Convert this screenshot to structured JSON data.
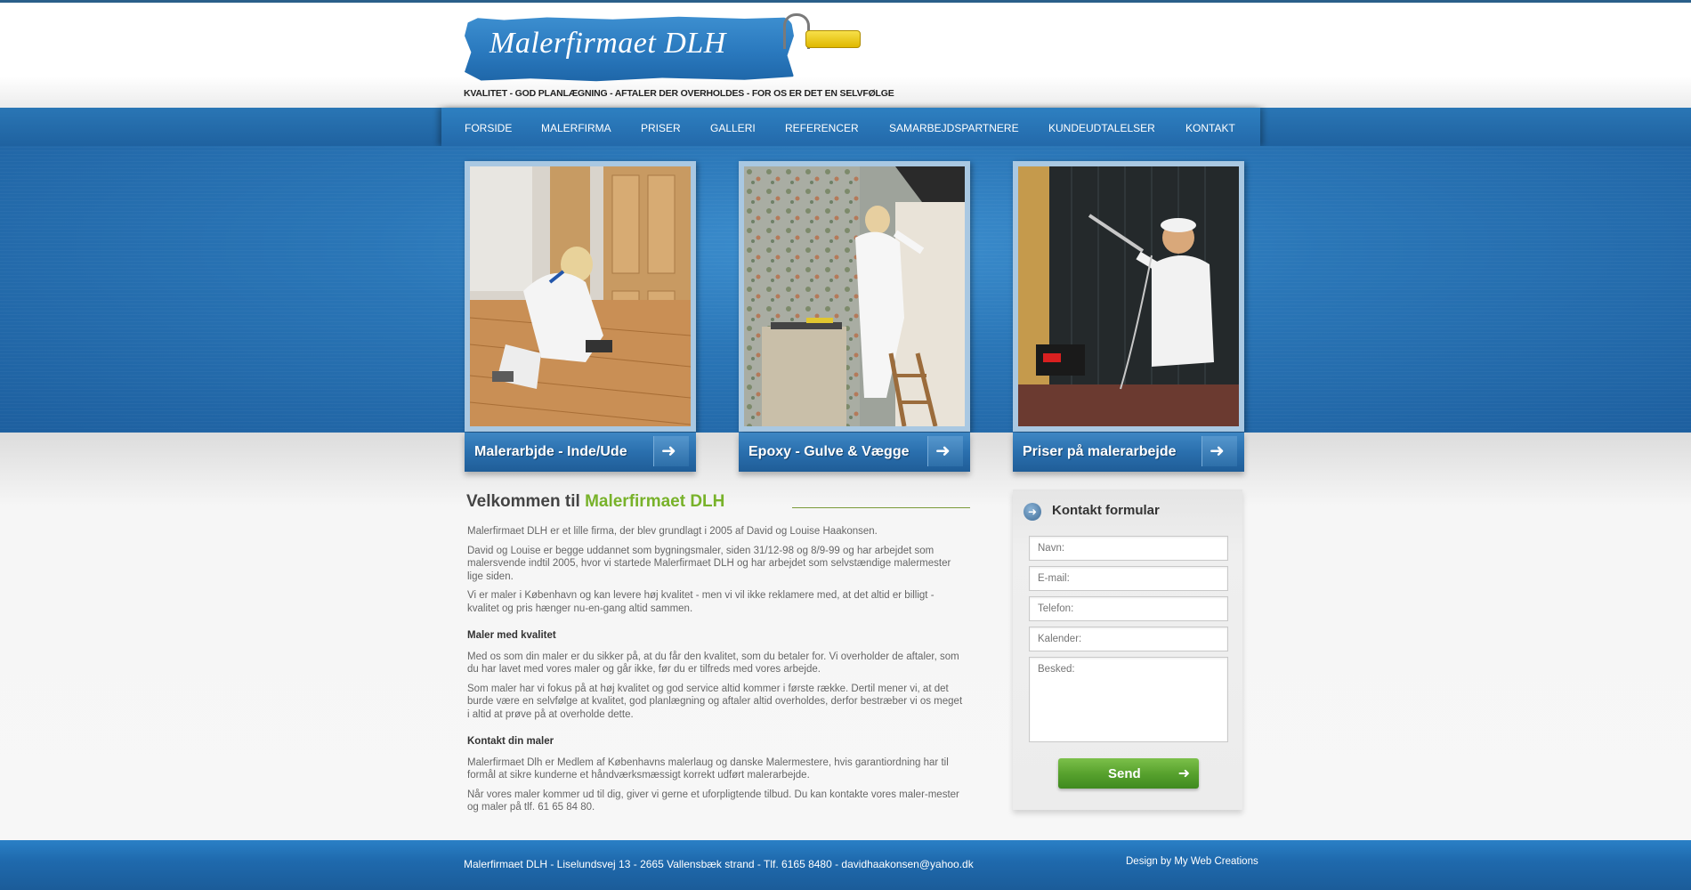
{
  "brand": {
    "logo_text": "Malerfirmaet DLH",
    "tagline": "KVALITET - GOD PLANLÆGNING - AFTALER DER OVERHOLDES - FOR OS ER DET EN SELVFØLGE"
  },
  "nav": {
    "items": [
      {
        "label": "FORSIDE"
      },
      {
        "label": "MALERFIRMA"
      },
      {
        "label": "PRISER"
      },
      {
        "label": "GALLERI"
      },
      {
        "label": "REFERENCER"
      },
      {
        "label": "SAMARBEJDSPARTNERE"
      },
      {
        "label": "KUNDEUDTALELSER"
      },
      {
        "label": "KONTAKT"
      }
    ]
  },
  "cards": [
    {
      "label": "Malerarbjde - Inde/Ude"
    },
    {
      "label": "Epoxy - Gulve & Vægge"
    },
    {
      "label": "Priser på malerarbejde"
    }
  ],
  "main": {
    "welcome_prefix": "Velkommen til",
    "welcome_highlight": "Malerfirmaet DLH",
    "paragraphs": [
      "Malerfirmaet DLH er et lille firma, der blev grundlagt i 2005 af David og Louise Haakonsen.",
      "David og Louise er begge uddannet som bygningsmaler, siden 31/12-98 og 8/9-99 og har arbejdet som malersvende indtil 2005, hvor vi startede Malerfirmaet DLH og har arbejdet som selvstændige malermester lige siden.",
      "Vi er maler i København og kan levere høj kvalitet - men vi vil ikke reklamere med, at det altid er billigt - kvalitet og pris hænger nu-en-gang altid sammen."
    ],
    "section1_heading": "Maler med kvalitet",
    "section1_paragraphs": [
      "Med os som din maler er du sikker på, at du får den kvalitet, som du betaler for. Vi overholder de aftaler, som du har lavet med vores maler og går ikke, før du er tilfreds med vores arbejde.",
      "Som maler har vi fokus på at høj kvalitet og god service altid kommer i første række. Dertil mener vi, at det burde være en selvfølge at kvalitet, god planlægning og aftaler altid overholdes, derfor bestræber vi os meget i altid at prøve på at overholde dette."
    ],
    "section2_heading": "Kontakt din maler",
    "section2_paragraphs": [
      "Malerfirmaet Dlh er Medlem af Københavns malerlaug og danske Malermestere, hvis garantiordning har til formål at sikre kunderne et håndværksmæssigt korrekt udført malerarbejde.",
      "Når vores maler kommer ud til dig, giver vi gerne et uforpligtende tilbud. Du kan kontakte vores maler-mester og maler på tlf. 61 65 84 80."
    ]
  },
  "contact_form": {
    "title": "Kontakt formular",
    "name_placeholder": "Navn:",
    "email_placeholder": "E-mail:",
    "phone_placeholder": "Telefon:",
    "calendar_placeholder": "Kalender:",
    "message_placeholder": "Besked:",
    "send_label": "Send"
  },
  "footer": {
    "address": "Malerfirmaet DLH - Liselundsvej 13 - 2665 Vallensbæk strand - Tlf. 6165 8480 - davidhaakonsen@yahoo.dk",
    "credit": "Design by My Web Creations"
  },
  "colors": {
    "primary_blue": "#2a76b5",
    "accent_green": "#78b22a",
    "send_green": "#58a22e"
  }
}
